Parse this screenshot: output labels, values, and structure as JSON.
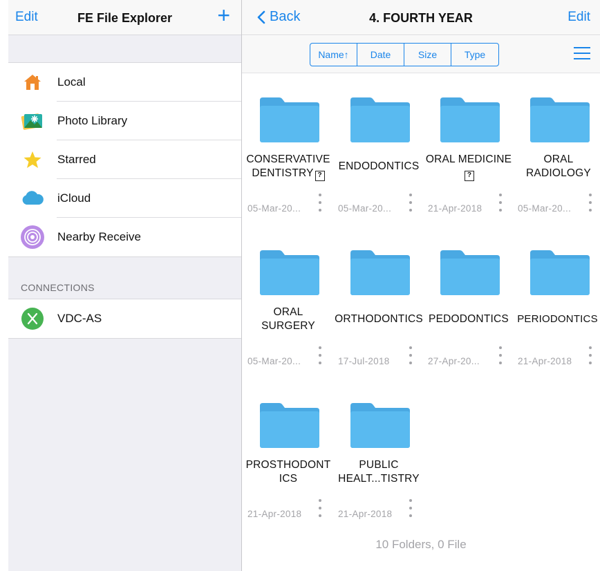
{
  "sidebar": {
    "edit_label": "Edit",
    "title": "FE File Explorer",
    "add_label": "+",
    "items": [
      {
        "label": "Local",
        "icon": "home-icon"
      },
      {
        "label": "Photo Library",
        "icon": "photo-library-icon"
      },
      {
        "label": "Starred",
        "icon": "star-icon"
      },
      {
        "label": "iCloud",
        "icon": "icloud-icon"
      },
      {
        "label": "Nearby Receive",
        "icon": "nearby-receive-icon"
      }
    ],
    "connections_caption": "CONNECTIONS",
    "connections": [
      {
        "label": "VDC-AS",
        "icon": "connection-x-icon"
      }
    ]
  },
  "main": {
    "back_label": "Back",
    "title": "4. FOURTH YEAR",
    "edit_label": "Edit",
    "sort_tabs": [
      "Name↑",
      "Date",
      "Size",
      "Type"
    ],
    "folders": [
      {
        "name": "CONSERVATIVE DENTISTRY",
        "date": "05-Mar-20...",
        "badge": "?"
      },
      {
        "name": "ENDODONTICS",
        "date": "05-Mar-20..."
      },
      {
        "name": "ORAL MEDICINE",
        "date": "21-Apr-2018",
        "badge": "?"
      },
      {
        "name": "ORAL RADIOLOGY",
        "date": "05-Mar-20..."
      },
      {
        "name": "ORAL SURGERY",
        "date": "05-Mar-20..."
      },
      {
        "name": "ORTHODONTICS",
        "date": "17-Jul-2018"
      },
      {
        "name": "PEDODONTICS",
        "date": "27-Apr-20..."
      },
      {
        "name": "PERIODONTICS",
        "date": "21-Apr-2018"
      },
      {
        "name": "PROSTHODONTICS",
        "date": "21-Apr-2018"
      },
      {
        "name": "PUBLIC HEALT...TISTRY",
        "date": "21-Apr-2018"
      }
    ],
    "footer": "10 Folders, 0 File"
  },
  "colors": {
    "accent": "#1a85ea",
    "folder": "#59baf0",
    "folder_tab": "#4aa9e3",
    "sidebar_bg": "#efeff4"
  }
}
